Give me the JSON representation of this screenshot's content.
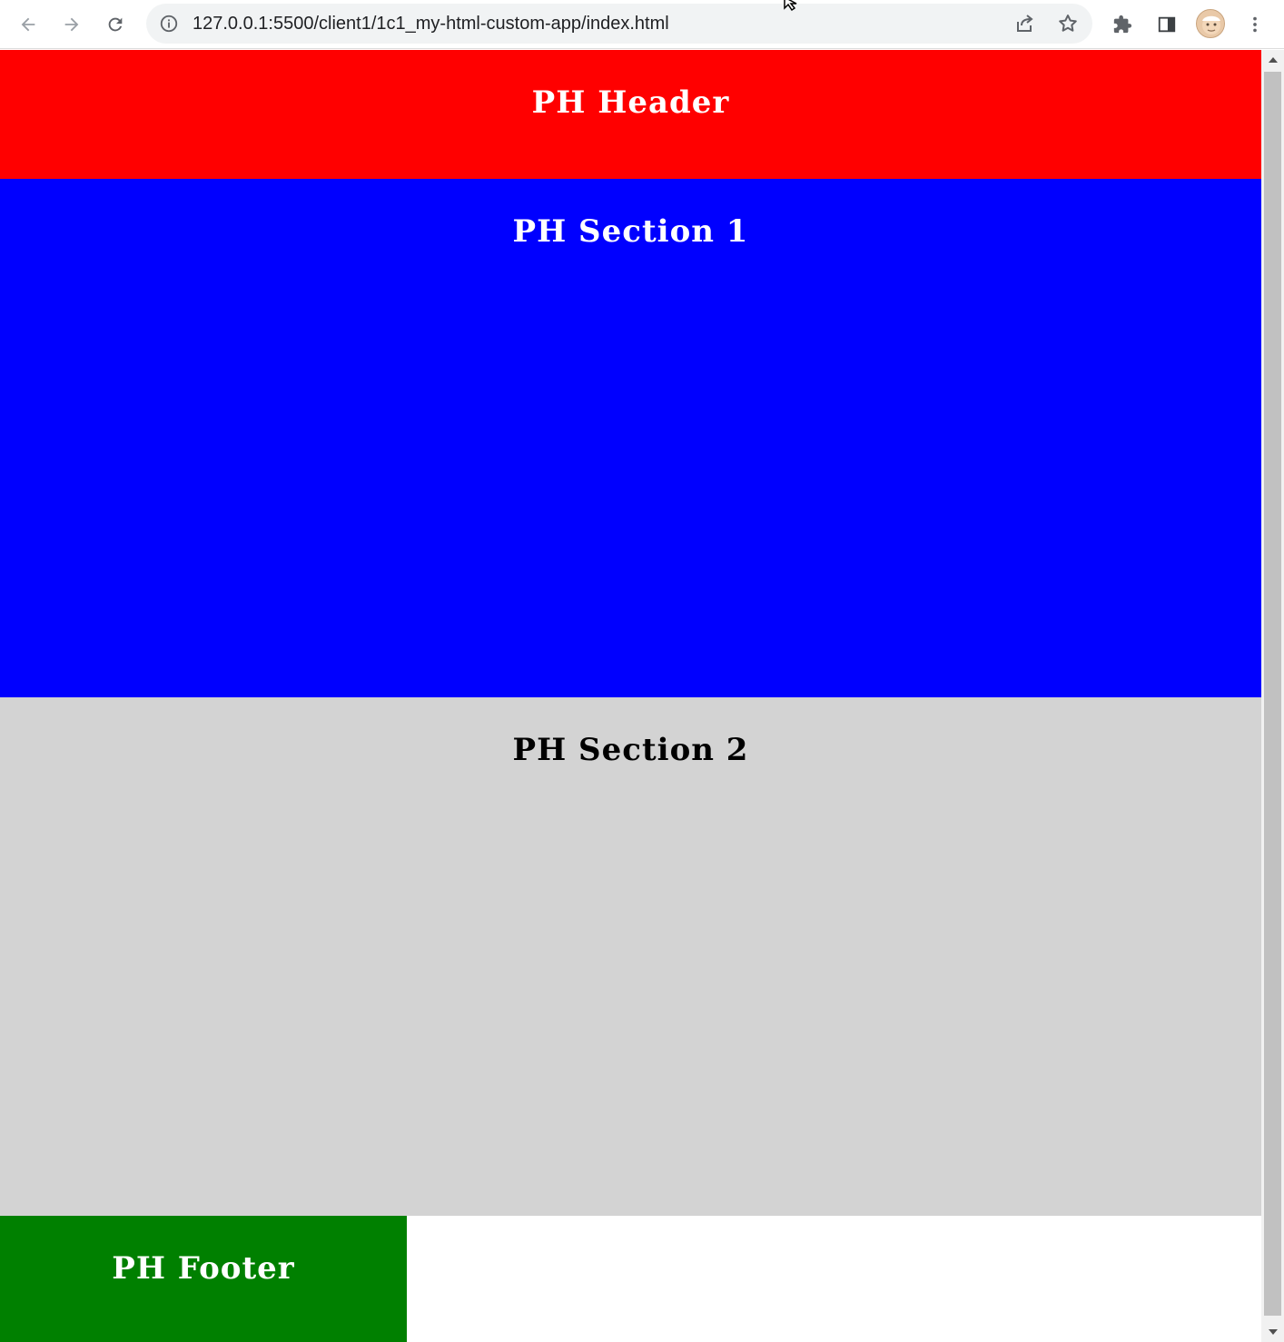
{
  "browser": {
    "url": "127.0.0.1:5500/client1/1c1_my-html-custom-app/index.html",
    "icons": {
      "back": "arrow-left-icon",
      "forward": "arrow-right-icon",
      "reload": "reload-icon",
      "site_info": "info-icon",
      "share": "share-icon",
      "bookmark": "star-icon",
      "extensions": "puzzle-icon",
      "side_panel": "side-panel-icon",
      "profile": "avatar",
      "menu": "kebab-menu-icon"
    }
  },
  "page": {
    "header": {
      "title": "PH Header",
      "bg": "#ff0000",
      "fg": "#ffffff"
    },
    "section1": {
      "title": "PH Section 1",
      "bg": "#0000ff",
      "fg": "#ffffff"
    },
    "section2": {
      "title": "PH Section 2",
      "bg": "#d3d3d3",
      "fg": "#000000"
    },
    "footer": {
      "title": "PH Footer",
      "bg": "#008000",
      "fg": "#ffffff"
    }
  }
}
